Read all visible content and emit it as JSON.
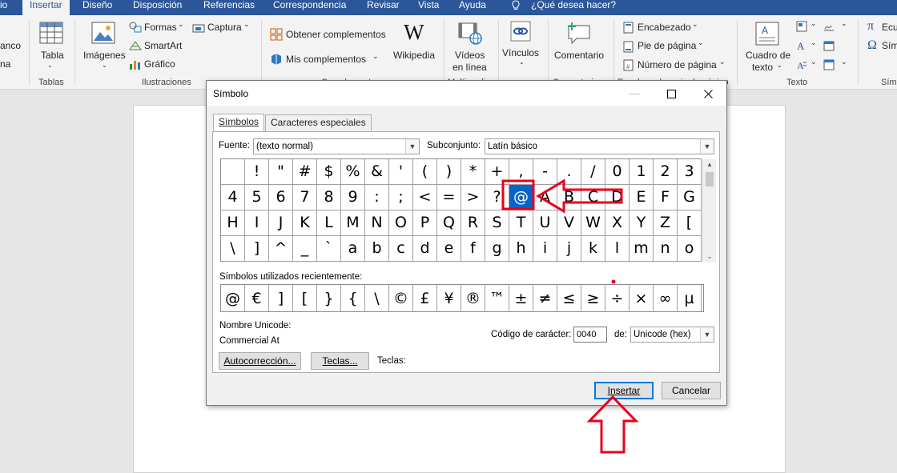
{
  "ribbon_tabs": [
    "io",
    "Insertar",
    "Diseño",
    "Disposición",
    "Referencias",
    "Correspondencia",
    "Revisar",
    "Vista",
    "Ayuda",
    "¿Qué desea hacer?"
  ],
  "ribbon": {
    "anco": "anco",
    "na": "na",
    "tabla": "Tabla",
    "tablas_group": "Tablas",
    "imagenes": "Imágenes",
    "formas": "Formas",
    "smartart": "SmartArt",
    "grafico": "Gráfico",
    "captura": "Captura",
    "ilustraciones_group": "Ilustraciones",
    "obtener_complementos": "Obtener complementos",
    "mis_complementos": "Mis complementos",
    "wikipedia": "Wikipedia",
    "videos_line1": "Vídeos",
    "videos_line2": "en línea",
    "vinculos": "Vínculos",
    "comentario": "Comentario",
    "encabezado": "Encabezado",
    "pie_de_pagina": "Pie de página",
    "numero_de_pagina": "Número de página",
    "cuadro_line1": "Cuadro de",
    "cuadro_line2": "texto",
    "texto_group": "Texto",
    "ecu": "Ecu",
    "sim": "Sím",
    "multi": "Multimedia",
    "complementos_group": "Complementos",
    "comentarios_group": "Comentarios",
    "encabezado_group": "Encabezado y pie de página"
  },
  "dialog": {
    "title": "Símbolo",
    "tab_simbolos": "Símbolos",
    "tab_caracteres": "Caracteres especiales",
    "fuente_label": "Fuente:",
    "fuente_value": "(texto normal)",
    "subconjunto_label": "Subconjunto:",
    "subconjunto_value": "Latín básico",
    "grid_rows": [
      [
        " ",
        "!",
        "\"",
        "#",
        "$",
        "%",
        "&",
        "'",
        "(",
        ")",
        "*",
        "+",
        ",",
        "-",
        ".",
        "/",
        "0",
        "1",
        "2",
        "3"
      ],
      [
        "4",
        "5",
        "6",
        "7",
        "8",
        "9",
        ":",
        ";",
        "<",
        "=",
        ">",
        "?",
        "@",
        "A",
        "B",
        "C",
        "D",
        "E",
        "F",
        "G"
      ],
      [
        "H",
        "I",
        "J",
        "K",
        "L",
        "M",
        "N",
        "O",
        "P",
        "Q",
        "R",
        "S",
        "T",
        "U",
        "V",
        "W",
        "X",
        "Y",
        "Z",
        "["
      ],
      [
        "\\",
        "]",
        "^",
        "_",
        "`",
        "a",
        "b",
        "c",
        "d",
        "e",
        "f",
        "g",
        "h",
        "i",
        "j",
        "k",
        "l",
        "m",
        "n",
        "o"
      ]
    ],
    "selected_char": "@",
    "recent_label": "Símbolos utilizados recientemente:",
    "recent": [
      "@",
      "€",
      "]",
      "[",
      "}",
      "{",
      "\\",
      "©",
      "£",
      "¥",
      "®",
      "™",
      "±",
      "≠",
      "≤",
      "≥",
      "÷",
      "×",
      "∞",
      "µ"
    ],
    "unicode_name_label": "Nombre Unicode:",
    "unicode_name_value": "Commercial At",
    "codigo_label": "Código de carácter:",
    "codigo_value": "0040",
    "de_label": "de:",
    "de_value": "Unicode (hex)",
    "autocorreccion_button": "Autocorrección...",
    "teclas_button": "Teclas...",
    "teclas_label": "Teclas:",
    "insertar_button": "Insertar",
    "cancelar_button": "Cancelar"
  },
  "colors": {
    "tabbar": "#2b579a",
    "selection": "#0a64c8",
    "annotation": "#e8001c"
  }
}
